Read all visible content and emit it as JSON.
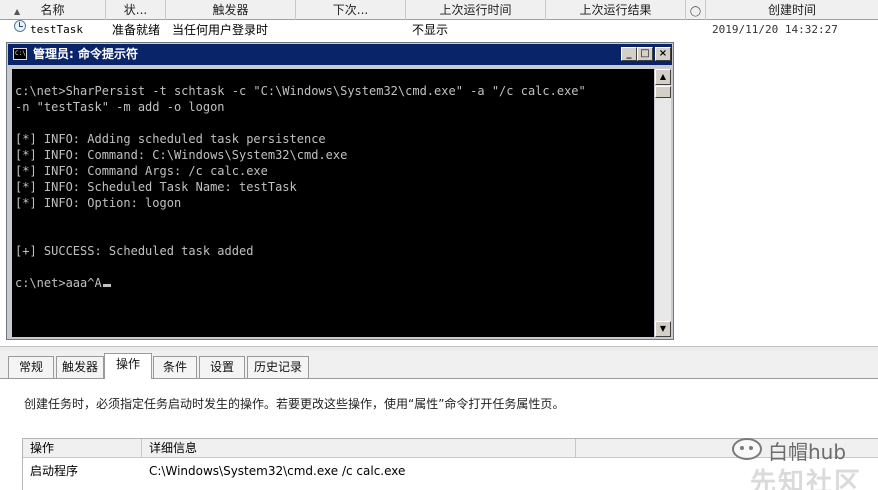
{
  "task_list": {
    "columns": [
      "名称",
      "状...",
      "触发器",
      "下次...",
      "上次运行时间",
      "上次运行结果",
      "创建时间"
    ],
    "row": {
      "name": "testTask",
      "status": "准备就绪",
      "trigger": "当任何用户登录时",
      "next_run": "",
      "last_run": "",
      "last_result": "不显示",
      "created": "2019/11/20 14:32:27"
    }
  },
  "cmd_window": {
    "title": "管理员: 命令提示符",
    "icon_text": "C:\\",
    "buttons": {
      "minimize": "_",
      "maximize": "□",
      "close": "×"
    },
    "lines": [
      "c:\\net>SharPersist -t schtask -c \"C:\\Windows\\System32\\cmd.exe\" -a \"/c calc.exe\"",
      "-n \"testTask\" -m add -o logon",
      "",
      "[*] INFO: Adding scheduled task persistence",
      "[*] INFO: Command: C:\\Windows\\System32\\cmd.exe",
      "[*] INFO: Command Args: /c calc.exe",
      "[*] INFO: Scheduled Task Name: testTask",
      "[*] INFO: Option: logon",
      "",
      "",
      "[+] SUCCESS: Scheduled task added",
      "",
      "c:\\net>aaa^A"
    ]
  },
  "tabs": [
    {
      "label": "常规",
      "active": false
    },
    {
      "label": "触发器",
      "active": false
    },
    {
      "label": "操作",
      "active": true
    },
    {
      "label": "条件",
      "active": false
    },
    {
      "label": "设置",
      "active": false
    },
    {
      "label": "历史记录",
      "active": false
    }
  ],
  "actions_panel": {
    "description": "创建任务时，必须指定任务启动时发生的操作。若要更改这些操作，使用“属性”命令打开任务属性页。",
    "headers": {
      "action": "操作",
      "details": "详细信息"
    },
    "rows": [
      {
        "action": "启动程序",
        "details": "C:\\Windows\\System32\\cmd.exe /c calc.exe"
      }
    ]
  },
  "watermark": {
    "text": "白帽hub",
    "sub": "先知社区"
  },
  "colors": {
    "title_bar": "#0a246a",
    "console_bg": "#000000",
    "console_text": "#c0c0c0"
  }
}
